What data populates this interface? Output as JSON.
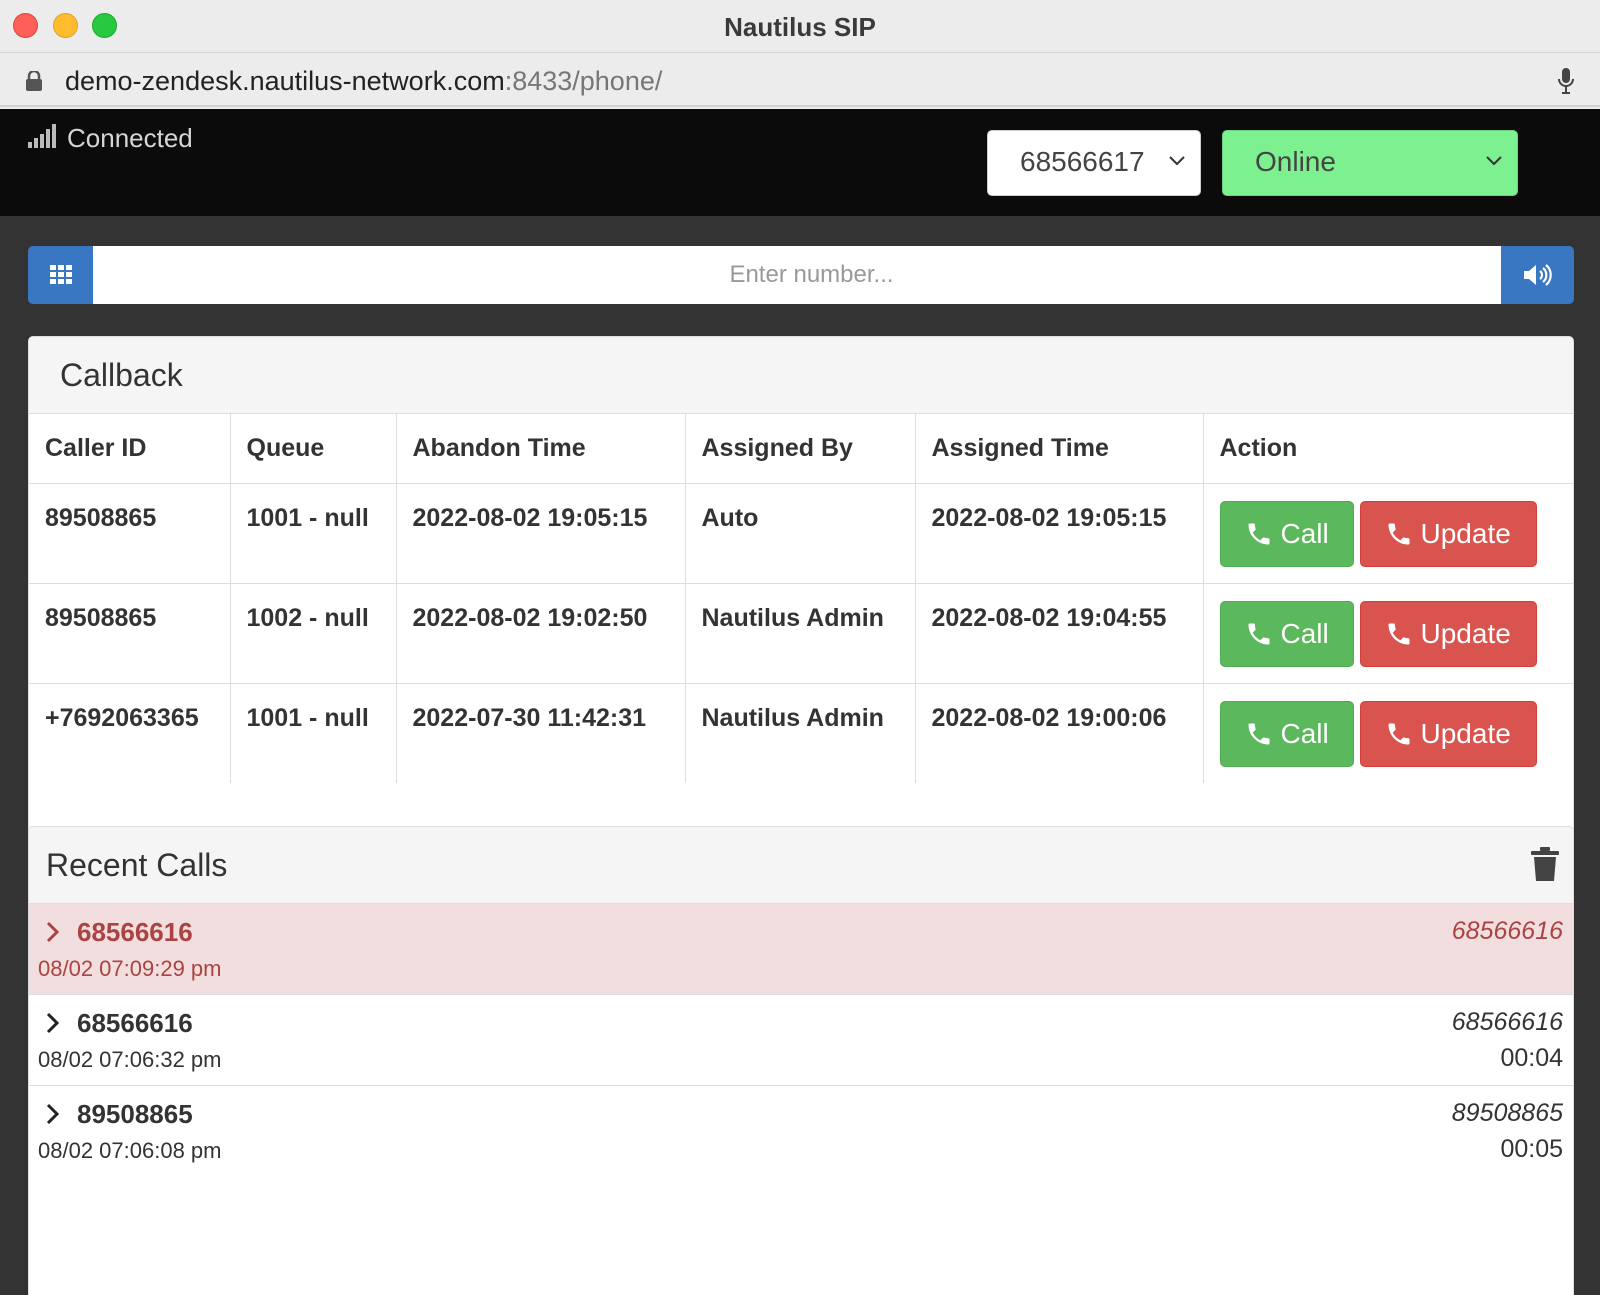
{
  "window": {
    "title": "Nautilus SIP"
  },
  "urlbar": {
    "host": "demo-zendesk.nautilus-network.com",
    "path": ":8433/phone/"
  },
  "topbar": {
    "status_label": "Connected",
    "extension": "68566617",
    "presence": "Online",
    "presence_color": "#7df08f"
  },
  "dialer": {
    "placeholder": "Enter number..."
  },
  "callback": {
    "title": "Callback",
    "columns": [
      "Caller ID",
      "Queue",
      "Abandon Time",
      "Assigned By",
      "Assigned Time",
      "Action"
    ],
    "rows": [
      {
        "caller_id": "89508865",
        "queue": "1001 - null",
        "abandon_time": "2022-08-02 19:05:15",
        "assigned_by": "Auto",
        "assigned_time": "2022-08-02 19:05:15"
      },
      {
        "caller_id": "89508865",
        "queue": "1002 - null",
        "abandon_time": "2022-08-02 19:02:50",
        "assigned_by": "Nautilus Admin",
        "assigned_time": "2022-08-02 19:04:55"
      },
      {
        "caller_id": "+7692063365",
        "queue": "1001 - null",
        "abandon_time": "2022-07-30 11:42:31",
        "assigned_by": "Nautilus Admin",
        "assigned_time": "2022-08-02 19:00:06"
      }
    ],
    "call_label": "Call",
    "update_label": "Update",
    "call_color": "#5cb85c",
    "update_color": "#d9534f"
  },
  "recent": {
    "title": "Recent Calls",
    "items": [
      {
        "number": "68566616",
        "time": "08/02 07:09:29 pm",
        "right": "68566616",
        "duration": "",
        "missed": true
      },
      {
        "number": "68566616",
        "time": "08/02 07:06:32 pm",
        "right": "68566616",
        "duration": "00:04",
        "missed": false
      },
      {
        "number": "89508865",
        "time": "08/02 07:06:08 pm",
        "right": "89508865",
        "duration": "00:05",
        "missed": false
      }
    ]
  },
  "icons": [
    "lock-icon",
    "microphone-icon",
    "signal-icon",
    "chevron-down-icon",
    "dialpad-icon",
    "volume-icon",
    "phone-icon",
    "trash-icon",
    "chevron-right-icon"
  ]
}
